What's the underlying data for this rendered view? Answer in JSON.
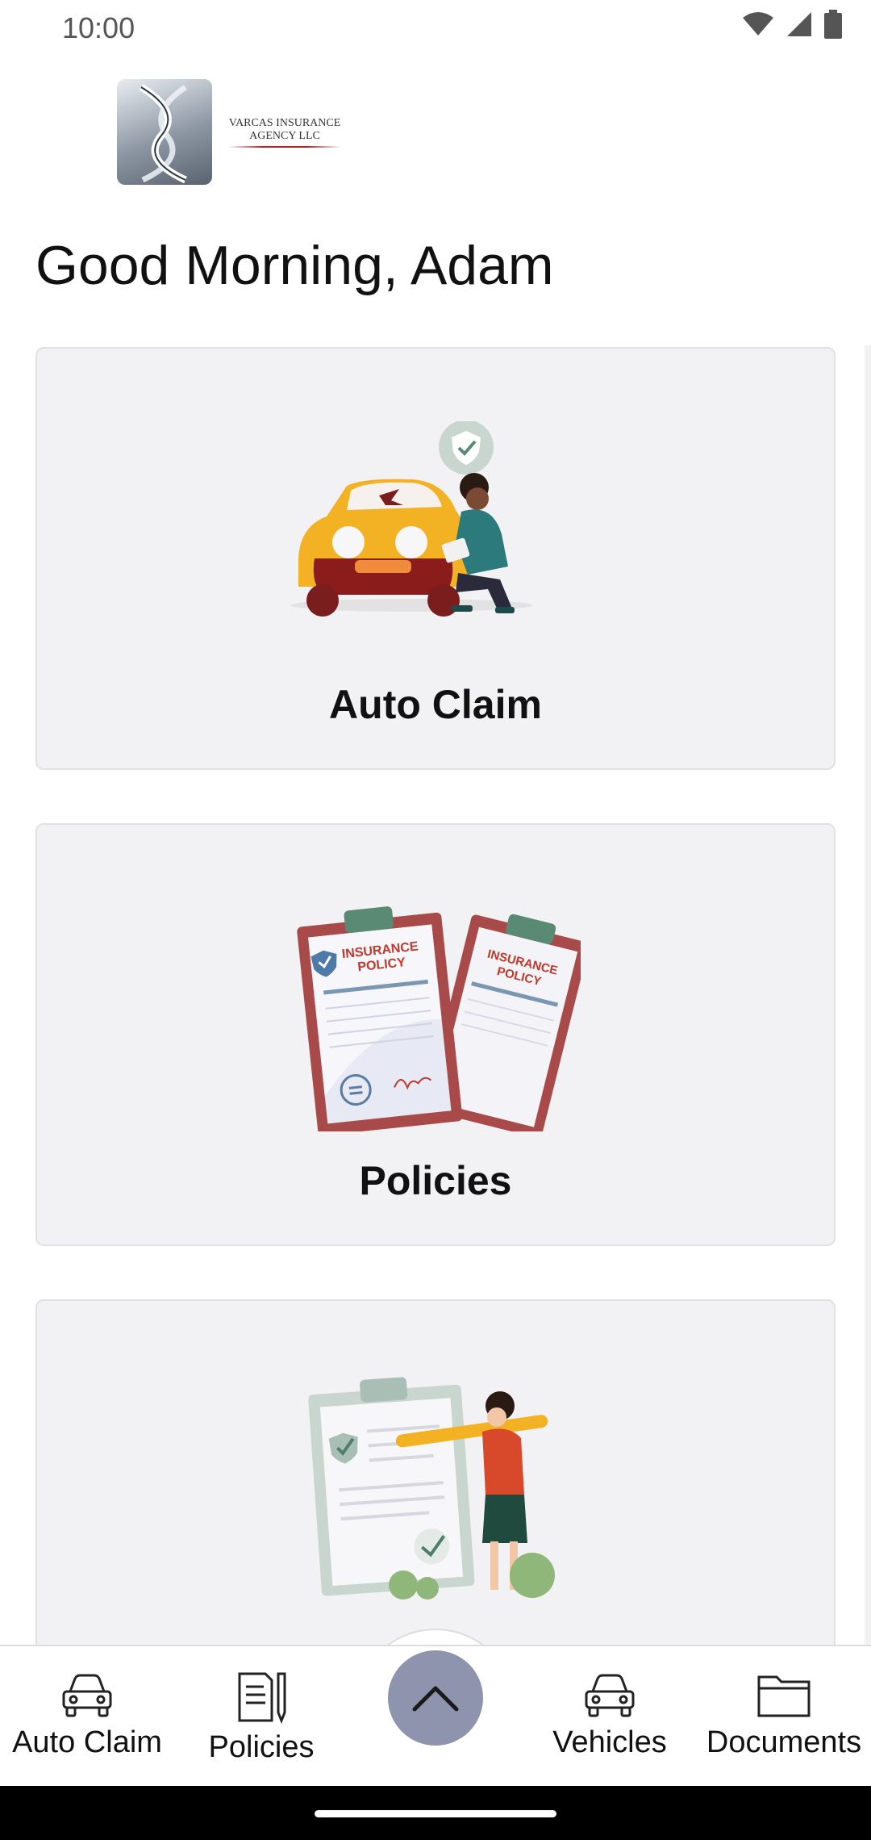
{
  "status_bar": {
    "time": "10:00",
    "icons": [
      "wifi-icon",
      "signal-icon",
      "battery-icon"
    ]
  },
  "logo": {
    "name_line1": "VARCAS INSURANCE",
    "name_line2": "AGENCY LLC"
  },
  "greeting": "Good Morning, Adam",
  "cards": [
    {
      "title": "Auto Claim",
      "art": "car-claim-illustration"
    },
    {
      "title": "Policies",
      "art": "insurance-policy-illustration"
    },
    {
      "title": "",
      "art": "checklist-illustration"
    }
  ],
  "bottom_nav": {
    "items": [
      {
        "label": "Auto Claim",
        "icon": "car-icon"
      },
      {
        "label": "Policies",
        "icon": "document-pen-icon"
      },
      {
        "label": "Vehicles",
        "icon": "car-icon"
      },
      {
        "label": "Documents",
        "icon": "folder-icon"
      }
    ],
    "center_button_icon": "chevron-up-icon"
  },
  "colors": {
    "card_bg": "#f2f2f4",
    "fab": "#8e94ad",
    "accent_red": "#c0392b",
    "policy_frame": "#a94a4a"
  }
}
